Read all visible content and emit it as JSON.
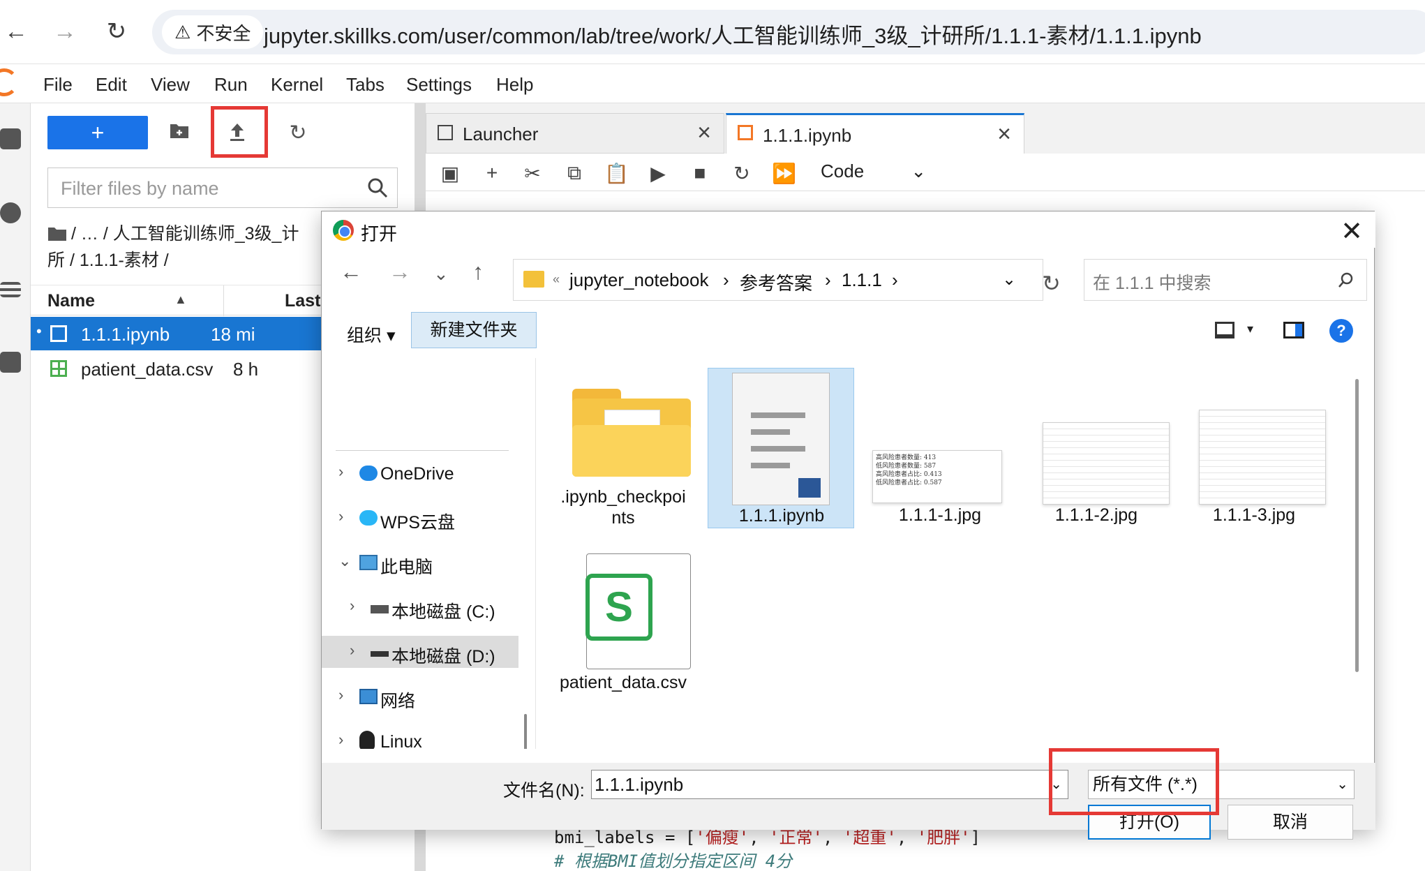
{
  "browser": {
    "back": "←",
    "forward": "→",
    "reload": "↻",
    "security_label": "不安全",
    "security_icon": "⚠",
    "url": "jupyter.skillks.com/user/common/lab/tree/work/人工智能训练师_3级_计研所/1.1.1-素材/1.1.1.ipynb"
  },
  "jupyter_menu": [
    "File",
    "Edit",
    "View",
    "Run",
    "Kernel",
    "Tabs",
    "Settings",
    "Help"
  ],
  "file_browser": {
    "new_button": "+",
    "filter_placeholder": "Filter files by name",
    "breadcrumb_line1": "/   …   / 人工智能训练师_3级_计",
    "breadcrumb_line2": "所 / 1.1.1-素材 /",
    "col_name": "Name",
    "col_last": "Last",
    "files": [
      {
        "name": "1.1.1.ipynb",
        "modified": "18 mi"
      },
      {
        "name": "patient_data.csv",
        "modified": "8 h"
      }
    ]
  },
  "tabs": [
    {
      "label": "Launcher"
    },
    {
      "label": "1.1.1.ipynb"
    }
  ],
  "notebook_toolbar": {
    "cell_type": "Code"
  },
  "code_lines": {
    "line1_var": "bmi_labels = [",
    "line1_s1": "'偏瘦'",
    "line1_s2": "'正常'",
    "line1_s3": "'超重'",
    "line1_s4": "'肥胖'",
    "line1_end": "]",
    "comma": ", ",
    "line2": "# 根据BMI值划分指定区间 4分"
  },
  "dialog": {
    "title": "打开",
    "close": "✕",
    "path": [
      "jupyter_notebook",
      "参考答案",
      "1.1.1"
    ],
    "path_prefix": "«",
    "search_placeholder": "在 1.1.1 中搜索",
    "organize": "组织 ▾",
    "new_folder": "新建文件夹",
    "help": "?",
    "nav_tree": [
      {
        "label": "OneDrive",
        "chevron": "›"
      },
      {
        "label": "WPS云盘",
        "chevron": "›"
      },
      {
        "label": "此电脑",
        "chevron": "⌄"
      },
      {
        "label": "本地磁盘 (C:)",
        "chevron": "›"
      },
      {
        "label": "本地磁盘 (D:)",
        "chevron": "›"
      },
      {
        "label": "网络",
        "chevron": "›"
      },
      {
        "label": "Linux",
        "chevron": "›"
      }
    ],
    "files": [
      {
        "name": ".ipynb_checkpoi nts"
      },
      {
        "name": "1.1.1.ipynb"
      },
      {
        "name": "1.1.1-1.jpg"
      },
      {
        "name": "1.1.1-2.jpg"
      },
      {
        "name": "1.1.1-3.jpg"
      },
      {
        "name": "patient_data.csv"
      }
    ],
    "thumb1": [
      "高风险患者数量: 413",
      "低风险患者数量: 587",
      "高风险患者占比: 0.413",
      "低风险患者占比: 0.587"
    ],
    "filename_label": "文件名(N):",
    "filename_value": "1.1.1.ipynb",
    "filetype": "所有文件 (*.*)",
    "open_button": "打开(O)",
    "cancel_button": "取消"
  },
  "colors": {
    "accent": "#1a73e8",
    "highlight": "#e53935",
    "selected_row": "#1976d2"
  }
}
